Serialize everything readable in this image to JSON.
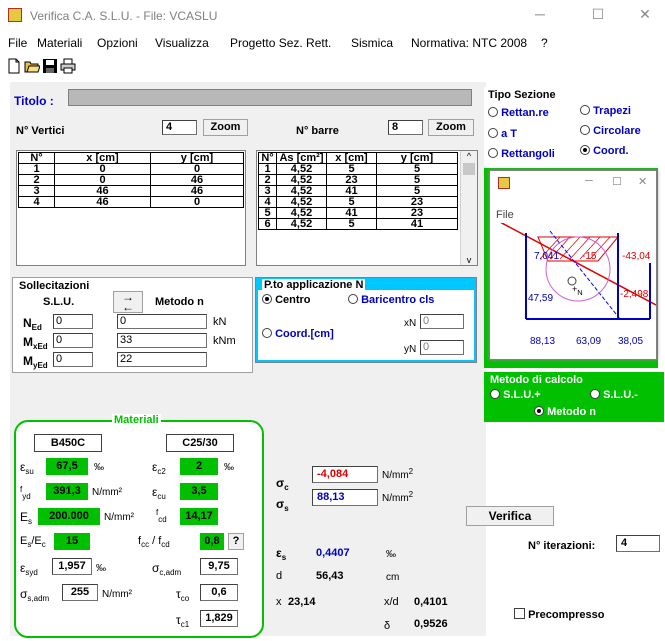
{
  "window": {
    "title": "Verifica C.A. S.L.U. - File: VCASLU"
  },
  "menu": [
    "File",
    "Materiali",
    "Opzioni",
    "Visualizza",
    "Progetto Sez. Rett.",
    "Sismica",
    "Normativa: NTC 2008",
    "?"
  ],
  "titolo": {
    "label": "Titolo :",
    "value": ""
  },
  "vertici": {
    "label": "N° Vertici",
    "count": "4",
    "zoom": "Zoom",
    "headers": [
      "N°",
      "x [cm]",
      "y [cm]"
    ],
    "rows": [
      [
        "1",
        "0",
        "0"
      ],
      [
        "2",
        "0",
        "46"
      ],
      [
        "3",
        "46",
        "46"
      ],
      [
        "4",
        "46",
        "0"
      ]
    ]
  },
  "barre": {
    "label": "N° barre",
    "count": "8",
    "zoom": "Zoom",
    "headers": [
      "N°",
      "As [cm²]",
      "x [cm]",
      "y [cm]"
    ],
    "rows": [
      [
        "1",
        "4,52",
        "5",
        "5"
      ],
      [
        "2",
        "4,52",
        "23",
        "5"
      ],
      [
        "3",
        "4,52",
        "41",
        "5"
      ],
      [
        "4",
        "4,52",
        "5",
        "23"
      ],
      [
        "5",
        "4,52",
        "41",
        "23"
      ],
      [
        "6",
        "4,52",
        "5",
        "41"
      ]
    ]
  },
  "tipo_sezione": {
    "title": "Tipo Sezione",
    "options": [
      "Rettan.re",
      "Trapezi",
      "a T",
      "Circolare",
      "Rettangoli",
      "Coord."
    ],
    "selected": "Coord."
  },
  "sollecitazioni": {
    "title": "Sollecitazioni",
    "slu": "S.L.U.",
    "metodo": "Metodo n",
    "NEd": "0",
    "MxEd": "0",
    "MyEd": "0",
    "v1": "0",
    "v2": "33",
    "v3": "22",
    "u1": "kN",
    "u2": "kNm"
  },
  "pto": {
    "title": "P.to applicazione N",
    "centro": "Centro",
    "baricentro": "Baricentro cls",
    "coord": "Coord.[cm]",
    "xN": "0",
    "yN": "0"
  },
  "popup": {
    "menu": "File",
    "labels": [
      "7,041",
      "-15",
      "-43,04",
      "47,59",
      "-2,498",
      "88,13",
      "63,09",
      "38,05"
    ]
  },
  "metodo_calcolo": {
    "title": "Metodo di calcolo",
    "slu_plus": "S.L.U.+",
    "slu_minus": "S.L.U.-",
    "metodo_n": "Metodo n"
  },
  "materiali": {
    "title": "Materiali",
    "steel": "B450C",
    "concrete": "C25/30",
    "esu": "67,5",
    "ec2": "2",
    "fyd": "391,3",
    "ecu": "3,5",
    "Es": "200.000",
    "fcd": "14,17",
    "ratio": "15",
    "fccfcd": "0,8",
    "esyd": "1,957",
    "sc_adm": "9,75",
    "ss_adm": "255",
    "tco": "0,6",
    "tc1": "1,829",
    "permil": "‰",
    "nmm2": "N/mm²",
    "q": "?"
  },
  "results": {
    "sigma_c": "-4,084",
    "sigma_s": "88,13",
    "unit": "N/mm",
    "eps_s": "0,4407",
    "d": "56,43",
    "cm": "cm",
    "x": "23,14",
    "xd": "0,4101",
    "delta": "0,9526"
  },
  "verifica": "Verifica",
  "iterazioni": {
    "label": "N° iterazioni:",
    "value": "4"
  },
  "precompresso": "Precompresso",
  "colors": {
    "green": "#00c000",
    "red": "#e00000",
    "blue": "#0000c0"
  }
}
